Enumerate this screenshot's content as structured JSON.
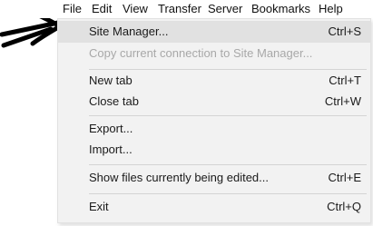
{
  "menubar": {
    "items": [
      {
        "label": "File"
      },
      {
        "label": "Edit"
      },
      {
        "label": "View"
      },
      {
        "label": "Transfer"
      },
      {
        "label": "Server"
      },
      {
        "label": "Bookmarks"
      },
      {
        "label": "Help"
      }
    ]
  },
  "file_menu": {
    "items": [
      {
        "label": "Site Manager...",
        "shortcut": "Ctrl+S",
        "state": "highlighted"
      },
      {
        "label": "Copy current connection to Site Manager...",
        "shortcut": "",
        "state": "disabled"
      },
      {
        "label": "New tab",
        "shortcut": "Ctrl+T",
        "state": "normal"
      },
      {
        "label": "Close tab",
        "shortcut": "Ctrl+W",
        "state": "normal"
      },
      {
        "label": "Export...",
        "shortcut": "",
        "state": "normal"
      },
      {
        "label": "Import...",
        "shortcut": "",
        "state": "normal"
      },
      {
        "label": "Show files currently being edited...",
        "shortcut": "Ctrl+E",
        "state": "normal"
      },
      {
        "label": "Exit",
        "shortcut": "Ctrl+Q",
        "state": "normal"
      }
    ]
  },
  "annotation": {
    "icon": "hand-drawn-arrow-icon",
    "color": "#000000"
  }
}
